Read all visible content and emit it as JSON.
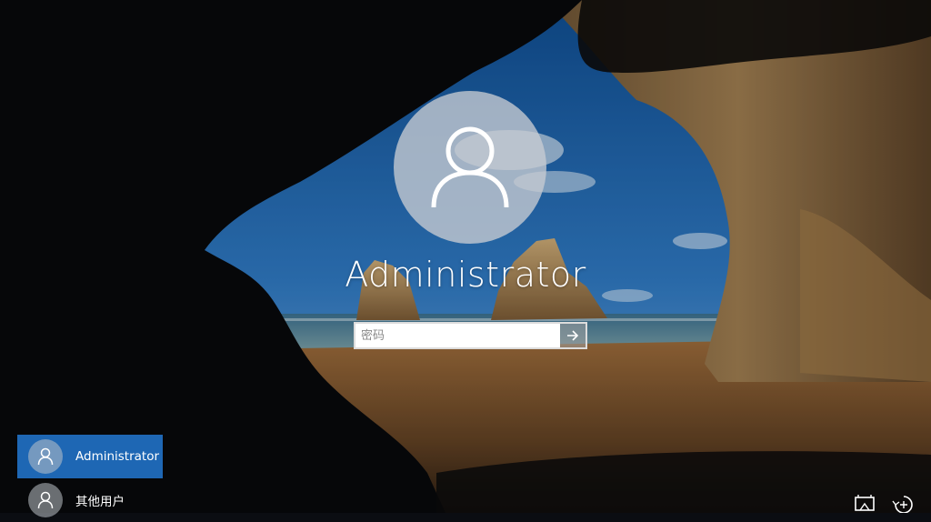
{
  "lock_screen": {
    "user_name": "Administrator",
    "password_placeholder": "密码"
  },
  "user_list": [
    {
      "label": "Administrator",
      "active": true
    },
    {
      "label": "其他用户",
      "active": false
    }
  ],
  "icons": {
    "large_avatar": "user-icon",
    "submit": "arrow-right-icon",
    "network": "network-icon",
    "accessibility": "ease-of-access-icon"
  },
  "colors": {
    "active_user_tile": "#1e67b4",
    "avatar_circle": "#c8ccd2"
  }
}
